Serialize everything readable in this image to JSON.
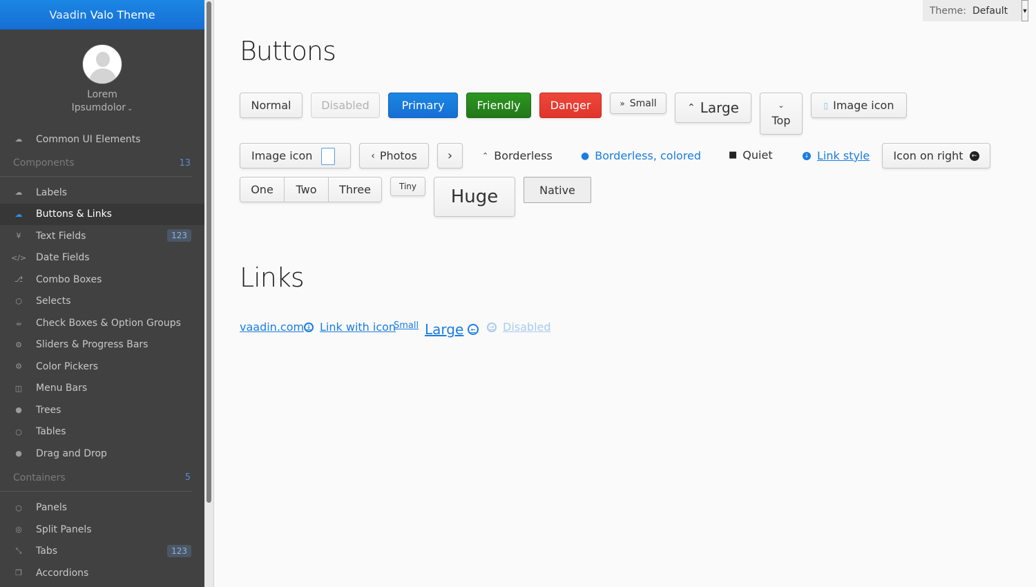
{
  "app": {
    "title_light": "Vaadin",
    "title_bold": "Valo Theme"
  },
  "user": {
    "first": "Lorem",
    "last": "Ipsumdolor"
  },
  "menu": {
    "common": "Common UI Elements",
    "components_header": "Components",
    "components_count": "13",
    "components": [
      {
        "label": "Labels",
        "icon": "cloud-upload-icon"
      },
      {
        "label": "Buttons & Links",
        "icon": "cloud-icon",
        "selected": true
      },
      {
        "label": "Text Fields",
        "icon": "yen-icon",
        "badge": "123"
      },
      {
        "label": "Date Fields",
        "icon": "code-icon"
      },
      {
        "label": "Combo Boxes",
        "icon": "branch-icon"
      },
      {
        "label": "Selects",
        "icon": "cube-icon"
      },
      {
        "label": "Check Boxes & Option Groups",
        "icon": "coffee-icon"
      },
      {
        "label": "Sliders & Progress Bars",
        "icon": "gear-icon"
      },
      {
        "label": "Color Pickers",
        "icon": "gears-icon"
      },
      {
        "label": "Menu Bars",
        "icon": "columns-icon"
      },
      {
        "label": "Trees",
        "icon": "comment-icon"
      },
      {
        "label": "Tables",
        "icon": "comment-outline-icon"
      },
      {
        "label": "Drag and Drop",
        "icon": "comments-icon"
      }
    ],
    "containers_header": "Containers",
    "containers_count": "5",
    "containers": [
      {
        "label": "Panels",
        "icon": "comments-outline-icon"
      },
      {
        "label": "Split Panels",
        "icon": "compass-icon"
      },
      {
        "label": "Tabs",
        "icon": "compress-icon",
        "badge": "123"
      },
      {
        "label": "Accordions",
        "icon": "copy-icon"
      }
    ]
  },
  "theme": {
    "label": "Theme:",
    "value": "Default"
  },
  "buttons": {
    "title": "Buttons",
    "normal": "Normal",
    "disabled": "Disabled",
    "primary": "Primary",
    "friendly": "Friendly",
    "danger": "Danger",
    "small": "Small",
    "large": "Large",
    "top": "Top",
    "image_icon": "Image icon",
    "image_icon_right": "Image icon",
    "photos": "Photos",
    "borderless": "Borderless",
    "borderless_colored": "Borderless, colored",
    "quiet": "Quiet",
    "link_style": "Link style",
    "icon_on_right": "Icon on right",
    "group": [
      "One",
      "Two",
      "Three"
    ],
    "tiny": "Tiny",
    "huge": "Huge",
    "native": "Native"
  },
  "links": {
    "title": "Links",
    "vaadin": "vaadin.com",
    "with_icon": "Link with icon",
    "small": "Small",
    "large": "Large",
    "disabled": "Disabled"
  },
  "colors": {
    "accent": "#197de1",
    "friendly": "#2c9720",
    "danger": "#ed473b",
    "sidebar": "#414141"
  }
}
